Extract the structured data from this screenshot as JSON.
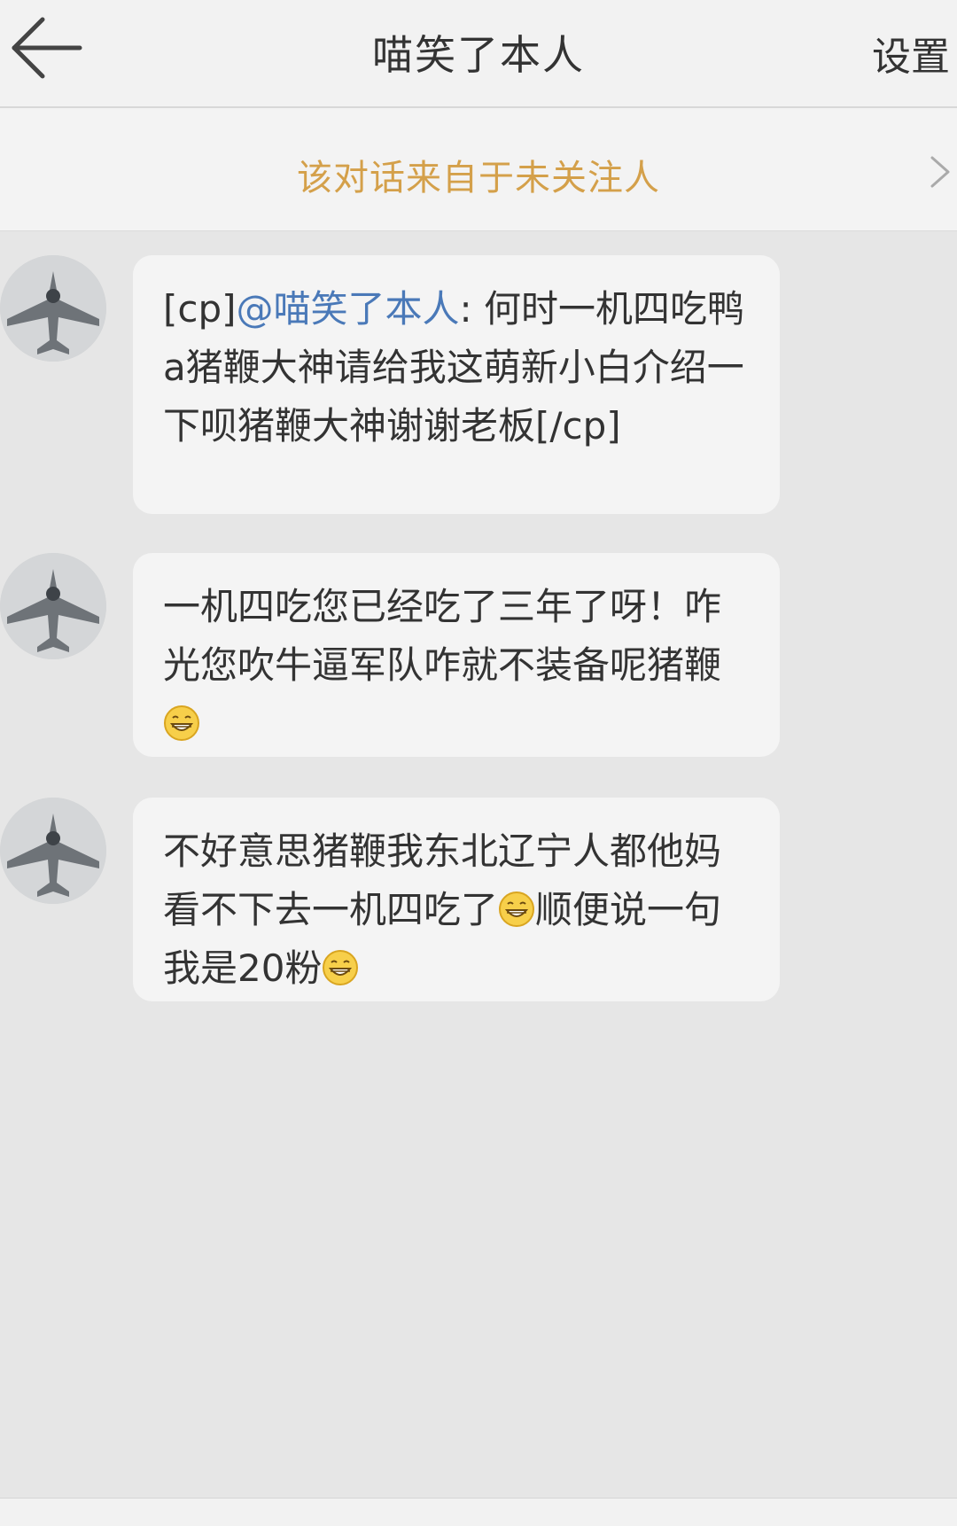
{
  "header": {
    "back_icon": "back-arrow-icon",
    "title": "喵笑了本人",
    "settings_label": "设置"
  },
  "notice": {
    "text": "该对话来自于未关注人",
    "chevron_icon": "chevron-right-icon"
  },
  "messages": [
    {
      "avatar_icon": "fighter-jet-avatar",
      "prefix": "[cp]",
      "mention": "@喵笑了本人",
      "text": ": 何时一机四吃鸭a猪鞭大神请给我这萌新小白介绍一下呗猪鞭大神谢谢老板[/cp]"
    },
    {
      "avatar_icon": "fighter-jet-avatar",
      "text": "一机四吃您已经吃了三年了呀！咋光您吹牛逼军队咋就不装备呢猪鞭",
      "emoji_icon": "grin-emoji-icon"
    },
    {
      "avatar_icon": "fighter-jet-avatar",
      "text_part1": "不好意思猪鞭我东北辽宁人都他妈看不下去一机四吃了",
      "text_part2": "顺便说一句我是20粉",
      "emoji_icon": "grin-emoji-icon"
    }
  ],
  "colors": {
    "background": "#e6e6e6",
    "notice_text": "#d4a04a",
    "mention": "#4a79b8"
  }
}
